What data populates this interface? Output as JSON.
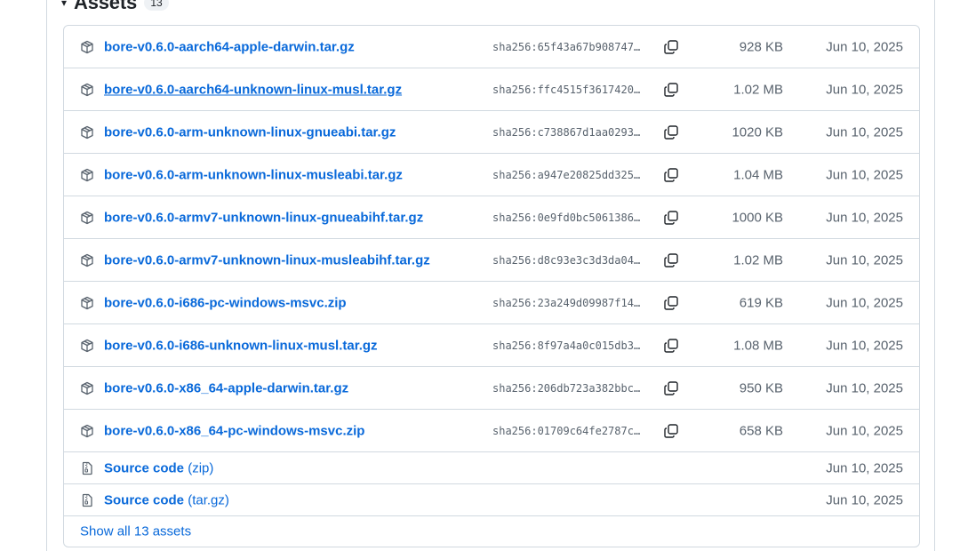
{
  "assets": {
    "title": "Assets",
    "count": "13",
    "files": [
      {
        "name": "bore-v0.6.0-aarch64-apple-darwin.tar.gz",
        "sha": "sha256:65f43a67b908747…",
        "size": "928 KB",
        "date": "Jun 10, 2025"
      },
      {
        "name": "bore-v0.6.0-aarch64-unknown-linux-musl.tar.gz",
        "sha": "sha256:ffc4515f3617420…",
        "size": "1.02 MB",
        "date": "Jun 10, 2025"
      },
      {
        "name": "bore-v0.6.0-arm-unknown-linux-gnueabi.tar.gz",
        "sha": "sha256:c738867d1aa0293…",
        "size": "1020 KB",
        "date": "Jun 10, 2025"
      },
      {
        "name": "bore-v0.6.0-arm-unknown-linux-musleabi.tar.gz",
        "sha": "sha256:a947e20825dd325…",
        "size": "1.04 MB",
        "date": "Jun 10, 2025"
      },
      {
        "name": "bore-v0.6.0-armv7-unknown-linux-gnueabihf.tar.gz",
        "sha": "sha256:0e9fd0bc5061386…",
        "size": "1000 KB",
        "date": "Jun 10, 2025"
      },
      {
        "name": "bore-v0.6.0-armv7-unknown-linux-musleabihf.tar.gz",
        "sha": "sha256:d8c93e3c3d3da04…",
        "size": "1.02 MB",
        "date": "Jun 10, 2025"
      },
      {
        "name": "bore-v0.6.0-i686-pc-windows-msvc.zip",
        "sha": "sha256:23a249d09987f14…",
        "size": "619 KB",
        "date": "Jun 10, 2025"
      },
      {
        "name": "bore-v0.6.0-i686-unknown-linux-musl.tar.gz",
        "sha": "sha256:8f97a4a0c015db3…",
        "size": "1.08 MB",
        "date": "Jun 10, 2025"
      },
      {
        "name": "bore-v0.6.0-x86_64-apple-darwin.tar.gz",
        "sha": "sha256:206db723a382bbc…",
        "size": "950 KB",
        "date": "Jun 10, 2025"
      },
      {
        "name": "bore-v0.6.0-x86_64-pc-windows-msvc.zip",
        "sha": "sha256:01709c64fe2787c…",
        "size": "658 KB",
        "date": "Jun 10, 2025"
      }
    ],
    "source": [
      {
        "label": "Source code",
        "suffix": "(zip)",
        "date": "Jun 10, 2025"
      },
      {
        "label": "Source code",
        "suffix": "(tar.gz)",
        "date": "Jun 10, 2025"
      }
    ],
    "show_all": "Show all 13 assets"
  },
  "icons": {
    "package": "package-icon",
    "copy": "copy-icon",
    "file_zip": "file-zip-icon",
    "caret": "triangle-down-icon"
  },
  "colors": {
    "link": "#0969da",
    "muted": "#59636e",
    "border": "#d1d9e0"
  }
}
